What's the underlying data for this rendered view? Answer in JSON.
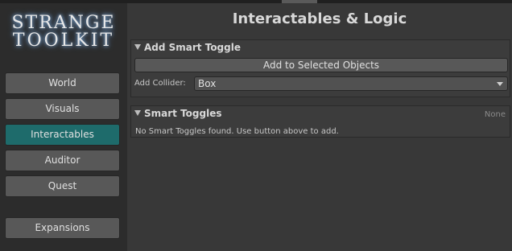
{
  "logo": {
    "line1": "STRANGE",
    "line2": "TOOLKIT"
  },
  "sidebar": {
    "items": [
      {
        "label": "World"
      },
      {
        "label": "Visuals"
      },
      {
        "label": "Interactables"
      },
      {
        "label": "Auditor"
      },
      {
        "label": "Quest"
      },
      {
        "label": "Expansions"
      }
    ],
    "active": "Interactables"
  },
  "main": {
    "title": "Interactables & Logic",
    "add_panel": {
      "header": "Add Smart Toggle",
      "button_label": "Add to Selected Objects",
      "collider_label": "Add Collider:",
      "collider_value": "Box"
    },
    "list_panel": {
      "header": "Smart Toggles",
      "count_label": "None",
      "empty_message": "No Smart Toggles found. Use button above to add."
    }
  },
  "colors": {
    "active_tab": "#1e6b6b",
    "sidebar_bg": "#2c2c2c",
    "main_bg": "#383838"
  },
  "icons": {
    "foldout": "triangle-down-icon",
    "dropdown": "chevron-down-icon"
  }
}
